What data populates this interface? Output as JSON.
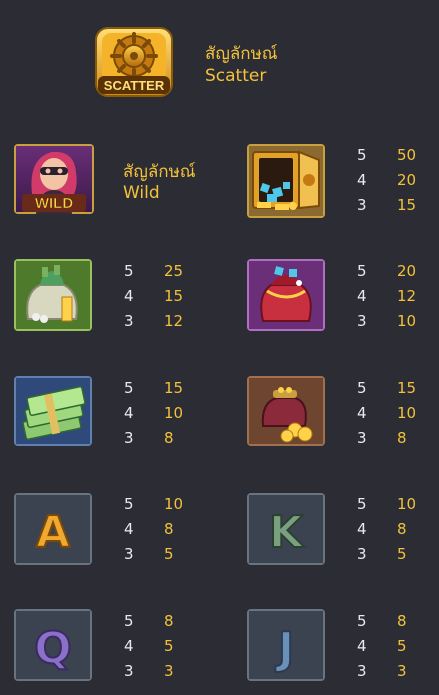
{
  "scatter": {
    "label_th": "สัญลักษณ์",
    "label_en": "Scatter",
    "icon_text": "SCATTER",
    "icon": "vault-wheel-icon"
  },
  "wild": {
    "label_th": "สัญลักษณ์",
    "label_en": "Wild",
    "icon_text": "WILD",
    "icon": "masked-thief-woman-icon"
  },
  "symbols": [
    {
      "id": "vault",
      "icon": "open-vault-gems-icon",
      "pays": [
        {
          "count": "5",
          "value": "50"
        },
        {
          "count": "4",
          "value": "20"
        },
        {
          "count": "3",
          "value": "15"
        }
      ]
    },
    {
      "id": "money-bag",
      "icon": "money-bag-gold-bar-icon",
      "pays": [
        {
          "count": "5",
          "value": "25"
        },
        {
          "count": "4",
          "value": "15"
        },
        {
          "count": "3",
          "value": "12"
        }
      ]
    },
    {
      "id": "jewel-bag",
      "icon": "jewel-pouch-icon",
      "pays": [
        {
          "count": "5",
          "value": "20"
        },
        {
          "count": "4",
          "value": "12"
        },
        {
          "count": "3",
          "value": "10"
        }
      ]
    },
    {
      "id": "cash-stack",
      "icon": "cash-stack-icon",
      "pays": [
        {
          "count": "5",
          "value": "15"
        },
        {
          "count": "4",
          "value": "10"
        },
        {
          "count": "3",
          "value": "8"
        }
      ]
    },
    {
      "id": "coin-purse",
      "icon": "coin-purse-icon",
      "pays": [
        {
          "count": "5",
          "value": "15"
        },
        {
          "count": "4",
          "value": "10"
        },
        {
          "count": "3",
          "value": "8"
        }
      ]
    },
    {
      "id": "letter-a",
      "letter": "A",
      "icon": "letter-a-icon",
      "pays": [
        {
          "count": "5",
          "value": "10"
        },
        {
          "count": "4",
          "value": "8"
        },
        {
          "count": "3",
          "value": "5"
        }
      ]
    },
    {
      "id": "letter-k",
      "letter": "K",
      "icon": "letter-k-icon",
      "pays": [
        {
          "count": "5",
          "value": "10"
        },
        {
          "count": "4",
          "value": "8"
        },
        {
          "count": "3",
          "value": "5"
        }
      ]
    },
    {
      "id": "letter-q",
      "letter": "Q",
      "icon": "letter-q-icon",
      "pays": [
        {
          "count": "5",
          "value": "8"
        },
        {
          "count": "4",
          "value": "5"
        },
        {
          "count": "3",
          "value": "3"
        }
      ]
    },
    {
      "id": "letter-j",
      "letter": "J",
      "icon": "letter-j-icon",
      "pays": [
        {
          "count": "5",
          "value": "8"
        },
        {
          "count": "4",
          "value": "5"
        },
        {
          "count": "3",
          "value": "3"
        }
      ]
    }
  ],
  "colors": {
    "background": "#2c2c35",
    "payout_value": "#f3c23a",
    "payout_count": "#e9e9ee",
    "tile_navy": "#2f4a7a",
    "tile_green": "#4e7a2c",
    "tile_purple": "#6a2f78",
    "tile_brown": "#6e4630",
    "tile_slate": "#3c4350"
  }
}
